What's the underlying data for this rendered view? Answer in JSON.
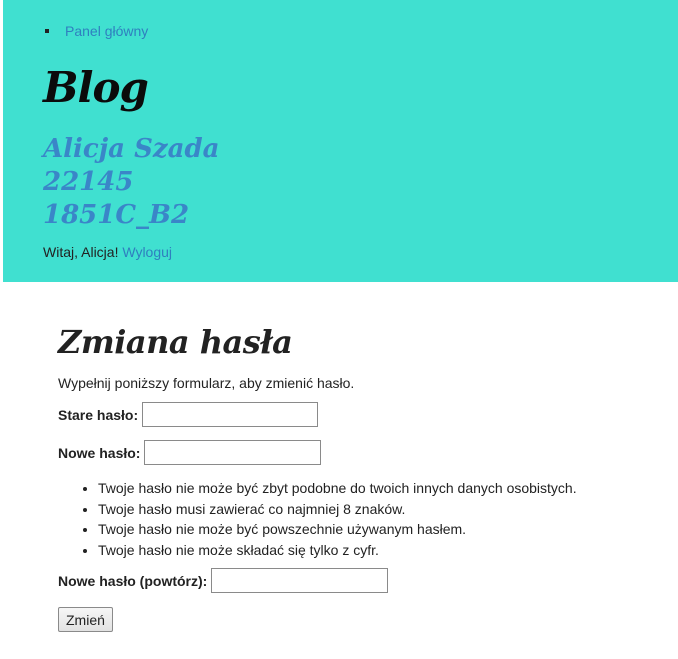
{
  "header": {
    "nav": [
      {
        "label": "Panel główny"
      }
    ],
    "blog_title": "Blog",
    "author_lines": [
      "Alicja Szada",
      "22145",
      "1851C_B2"
    ],
    "welcome_text": "Witaj, Alicja!",
    "logout_label": "Wyloguj"
  },
  "main": {
    "title": "Zmiana hasła",
    "intro": "Wypełnij poniższy formularz, aby zmienić hasło.",
    "old_password_label": "Stare hasło:",
    "old_password_value": "",
    "new_password_label": "Nowe hasło:",
    "new_password_value": "",
    "help_items": [
      "Twoje hasło nie może być zbyt podobne do twoich innych danych osobistych.",
      "Twoje hasło musi zawierać co najmniej 8 znaków.",
      "Twoje hasło nie może być powszechnie używanym hasłem.",
      "Twoje hasło nie może składać się tylko z cyfr."
    ],
    "new_password_repeat_label": "Nowe hasło (powtórz):",
    "new_password_repeat_value": "",
    "submit_label": "Zmień"
  },
  "colors": {
    "header_background": "#40e0d0",
    "link": "#2f7fbf",
    "author_text": "#3a86c8"
  }
}
